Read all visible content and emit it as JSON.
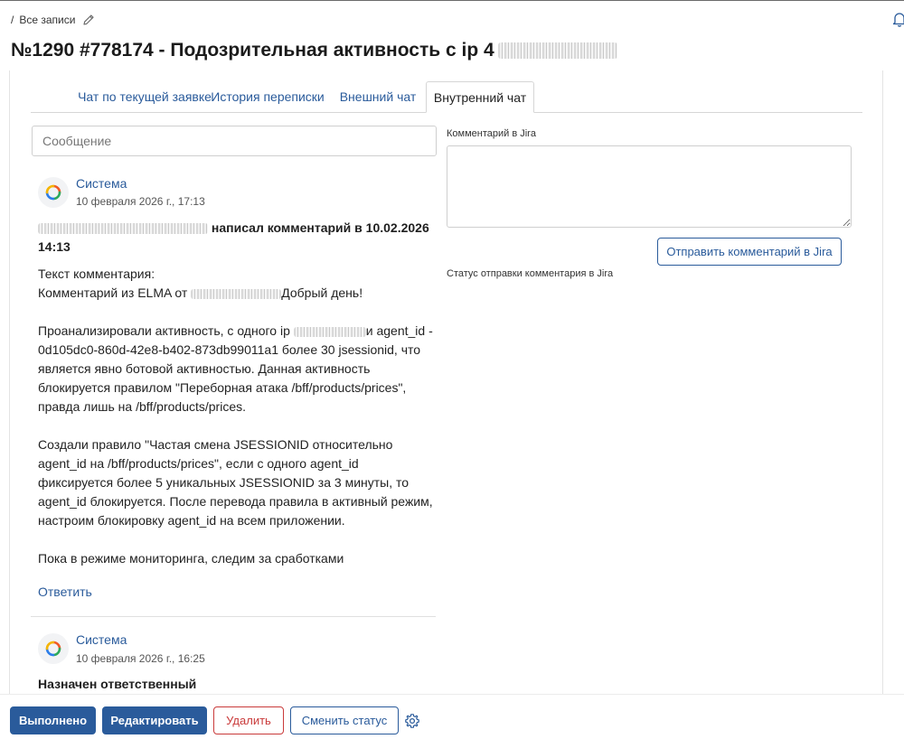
{
  "header": {
    "breadcrumb_sep": "/",
    "breadcrumb": "Все записи",
    "title": "№1290 #778174 - Подозрительная активность с ip 4"
  },
  "tabs": [
    {
      "label": "Чат по текущей заявке",
      "active": false
    },
    {
      "label": "История переписки",
      "active": false
    },
    {
      "label": "Внешний чат",
      "active": false
    },
    {
      "label": "Внутренний чат",
      "active": true
    }
  ],
  "message_input": {
    "placeholder": "Сообщение",
    "value": ""
  },
  "feed": [
    {
      "author": "Система",
      "date": "10 февраля 2026 г., 17:13",
      "headline_suffix": " написал комментарий в 10.02.2026 14:13",
      "body": {
        "line1": "Текст комментария:",
        "line2_prefix": "Комментарий из ELMA от ",
        "line2_suffix": "Добрый день!",
        "p2_prefix": "Проанализировали активность, с одного ip ",
        "p2_suffix": "и agent_id - 0d105dc0-860d-42e8-b402-873db99011a1 более 30 jsessionid, что является явно ботовой активностью.  Данная активность блокируется правилом \"Переборная атака /bff/products/prices\", правда лишь на /bff/products/prices.",
        "p3": "Создали правило \"Частая смена JSESSIONID относительно agent_id на /bff/products/prices\", если с одного agent_id фиксируется более 5 уникальных JSESSIONID за 3 минуты, то agent_id блокируется. После перевода правила в активный режим, настроим блокировку agent_id на всем приложении.",
        "p4": "Пока в режиме мониторинга, следим за сработками"
      },
      "reply_label": "Ответить"
    },
    {
      "author": "Система",
      "date": "10 февраля 2026 г., 16:25",
      "headline": "Назначен ответственный"
    }
  ],
  "jira": {
    "label": "Комментарий в Jira",
    "textarea_value": "",
    "send_label": "Отправить комментарий в Jira",
    "status_label": "Статус отправки комментария в Jira"
  },
  "footer": {
    "done_label": "Выполнено",
    "edit_label": "Редактировать",
    "delete_label": "Удалить",
    "status_label": "Сменить статус"
  },
  "icons": {
    "edit": "pencil-icon",
    "bell": "bell-icon",
    "settings": "gear-icon",
    "avatar": "system-logo-icon"
  },
  "colors": {
    "link": "#2a5b9b",
    "primary_button": "#2a5b9b",
    "danger": "#c93a3a"
  }
}
